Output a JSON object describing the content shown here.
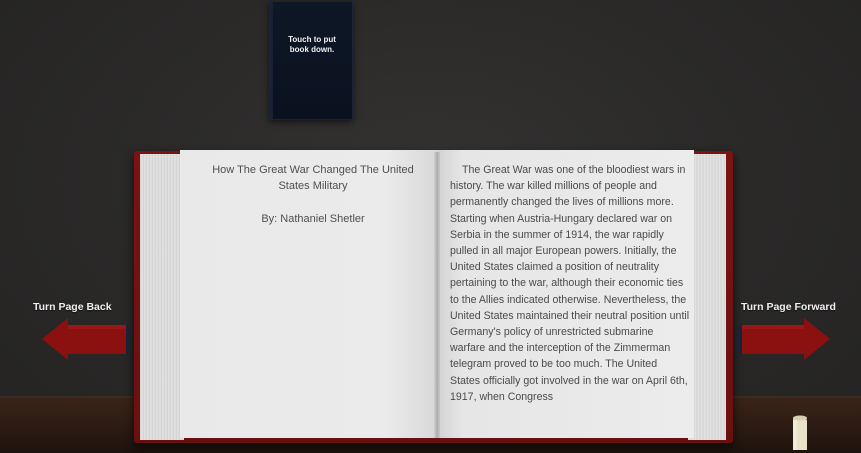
{
  "closed_book": {
    "label": "Touch to put book down."
  },
  "book": {
    "left_page": {
      "title": "How The Great War Changed The United States Military",
      "author": "By: Nathaniel Shetler"
    },
    "right_page": {
      "text": "The Great War was one of the bloodiest wars in history. The war killed millions of people and permanently changed the lives of millions more. Starting when Austria-Hungary declared war on Serbia in the summer of 1914, the war rapidly pulled in all major European powers. Initially, the United States claimed a position of neutrality pertaining to the war, although their economic ties to the Allies indicated otherwise. Nevertheless, the United States maintained their neutral position until Germany's policy of unrestricted submarine warfare and the interception of the Zimmerman telegram proved to be too much. The United States officially got involved in the war on April 6th, 1917, when Congress"
    }
  },
  "navigation": {
    "back_label": "Turn Page Back",
    "forward_label": "Turn Page Forward"
  },
  "colors": {
    "cover": "#7c1313",
    "arrow": "#8b1010",
    "closed_book": "#0e1726",
    "page": "#ebebeb"
  }
}
